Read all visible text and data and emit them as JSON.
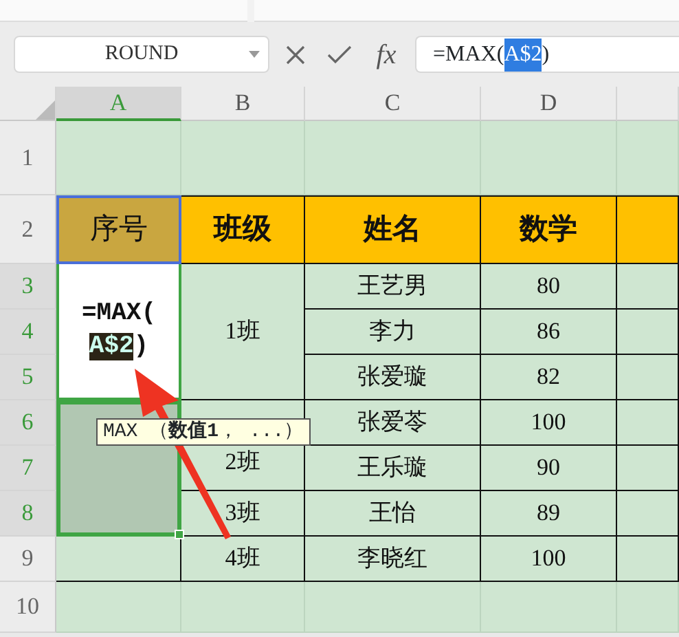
{
  "name_box": {
    "value": "ROUND"
  },
  "formula_bar": {
    "function_label": "fx",
    "parts": [
      {
        "text": "=MAX(",
        "highlighted": false
      },
      {
        "text": "A$2",
        "highlighted": true
      },
      {
        "text": ")",
        "highlighted": false
      }
    ]
  },
  "columns": [
    {
      "label": "A",
      "selected": true
    },
    {
      "label": "B",
      "selected": false
    },
    {
      "label": "C",
      "selected": false
    },
    {
      "label": "D",
      "selected": false
    }
  ],
  "rows": [
    {
      "label": "1",
      "selected": false,
      "cells": [
        {
          "kind": "empty"
        },
        {
          "kind": "empty"
        },
        {
          "kind": "empty"
        },
        {
          "kind": "empty"
        },
        {
          "kind": "empty"
        }
      ]
    },
    {
      "label": "2",
      "selected": false,
      "cells": [
        {
          "kind": "active-header",
          "text": "序号"
        },
        {
          "kind": "header",
          "text": "班级"
        },
        {
          "kind": "header",
          "text": "姓名"
        },
        {
          "kind": "header",
          "text": "数学"
        },
        {
          "kind": "header"
        }
      ]
    },
    {
      "label": "3",
      "selected": true,
      "cells": [
        {
          "kind": "editing",
          "parts": [
            {
              "text": "=MAX(",
              "highlighted": false
            },
            {
              "text": "A$2",
              "highlighted": true
            },
            {
              "text": ")",
              "highlighted": false
            }
          ]
        },
        {
          "kind": "data",
          "text": "1班"
        },
        {
          "kind": "data",
          "text": "王艺男"
        },
        {
          "kind": "data",
          "text": "80"
        },
        {
          "kind": "data"
        }
      ]
    },
    {
      "label": "4",
      "selected": true,
      "cells": [
        {
          "kind": "merged"
        },
        {
          "kind": "merged"
        },
        {
          "kind": "data",
          "text": "李力"
        },
        {
          "kind": "data",
          "text": "86"
        },
        {
          "kind": "data"
        }
      ]
    },
    {
      "label": "5",
      "selected": true,
      "cells": [
        {
          "kind": "merged"
        },
        {
          "kind": "merged"
        },
        {
          "kind": "data",
          "text": "张爱璇"
        },
        {
          "kind": "data",
          "text": "82"
        },
        {
          "kind": "data"
        }
      ]
    },
    {
      "label": "6",
      "selected": true,
      "cells": [
        {
          "kind": "selected"
        },
        {
          "kind": "data",
          "text": "2班"
        },
        {
          "kind": "data",
          "text": "张爱苓"
        },
        {
          "kind": "data",
          "text": "100"
        },
        {
          "kind": "data"
        }
      ]
    },
    {
      "label": "7",
      "selected": true,
      "cells": [
        {
          "kind": "merged"
        },
        {
          "kind": "merged"
        },
        {
          "kind": "data",
          "text": "王乐璇"
        },
        {
          "kind": "data",
          "text": "90"
        },
        {
          "kind": "data"
        }
      ]
    },
    {
      "label": "8",
      "selected": true,
      "cells": [
        {
          "kind": "merged"
        },
        {
          "kind": "data",
          "text": "3班"
        },
        {
          "kind": "data",
          "text": "王怡"
        },
        {
          "kind": "data",
          "text": "89"
        },
        {
          "kind": "data"
        }
      ]
    },
    {
      "label": "9",
      "selected": false,
      "cells": [
        {
          "kind": "data"
        },
        {
          "kind": "data",
          "text": "4班"
        },
        {
          "kind": "data",
          "text": "李晓红"
        },
        {
          "kind": "data",
          "text": "100"
        },
        {
          "kind": "data"
        }
      ]
    },
    {
      "label": "10",
      "selected": false,
      "cells": [
        {
          "kind": "empty"
        },
        {
          "kind": "empty"
        },
        {
          "kind": "empty"
        },
        {
          "kind": "empty"
        },
        {
          "kind": "empty"
        }
      ]
    }
  ],
  "tooltip": {
    "text": "MAX （**数值1**， ...）"
  }
}
